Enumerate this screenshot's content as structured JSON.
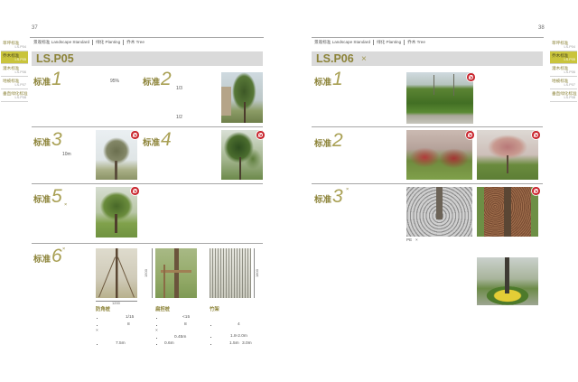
{
  "sidebar": {
    "items": [
      {
        "label": "草坪标准",
        "code": "LS.P04",
        "active": false
      },
      {
        "label": "乔木标准",
        "code": "LS.P05",
        "active": true
      },
      {
        "label": "灌木标准",
        "code": "LS.P06",
        "active": false
      },
      {
        "label": "地被标准",
        "code": "LS.P07",
        "active": false
      },
      {
        "label": "垂直绿化标准",
        "code": "LS.P08",
        "active": false
      }
    ]
  },
  "left_page": {
    "page_number": "37",
    "breadcrumb": [
      "景观标准 Landscape Standard",
      "绿化 Planting",
      "乔木 Tree"
    ],
    "code": "LS.P05",
    "standards": [
      {
        "label": "标准",
        "number": "1",
        "notes": [
          "95%"
        ]
      },
      {
        "label": "标准",
        "number": "2",
        "notes": [
          "1/3",
          "1/2"
        ]
      },
      {
        "label": "标准",
        "number": "3",
        "notes": [
          "10m"
        ]
      },
      {
        "label": "标准",
        "number": "4"
      },
      {
        "label": "标准",
        "number": "5",
        "notes": [
          "×"
        ]
      },
      {
        "label": "标准",
        "number": "6",
        "notes": [
          "×"
        ]
      }
    ],
    "staking": {
      "dimensions": [
        "1200",
        "1500",
        "1800"
      ],
      "methods": [
        {
          "name": "防角桩",
          "values": [
            "1/15",
            "8",
            "×",
            "7.5m"
          ]
        },
        {
          "name": "扁担桩",
          "values": [
            "<15",
            "8",
            "×",
            "0.45m",
            "0.6m"
          ]
        },
        {
          "name": "竹架",
          "values": [
            "4",
            "1.8-2.0m",
            "1.5m",
            "3.0m"
          ]
        }
      ]
    }
  },
  "right_page": {
    "page_number": "38",
    "breadcrumb": [
      "景观标准 Landscape Standard",
      "绿化 Planting",
      "乔木 Tree"
    ],
    "code": "LS.P06",
    "code_mark": "×",
    "standards": [
      {
        "label": "标准",
        "number": "1"
      },
      {
        "label": "标准",
        "number": "2"
      },
      {
        "label": "标准",
        "number": "3",
        "notes": [
          "×"
        ],
        "caption": [
          "PE",
          "×"
        ]
      }
    ]
  },
  "colors": {
    "accent": "#8c8338",
    "sidebar_highlight": "#c9c43c",
    "title_bar": "#dadada",
    "badge": "#c9262e"
  },
  "icons": {
    "photo_badge": "prohibited-badge-icon"
  }
}
